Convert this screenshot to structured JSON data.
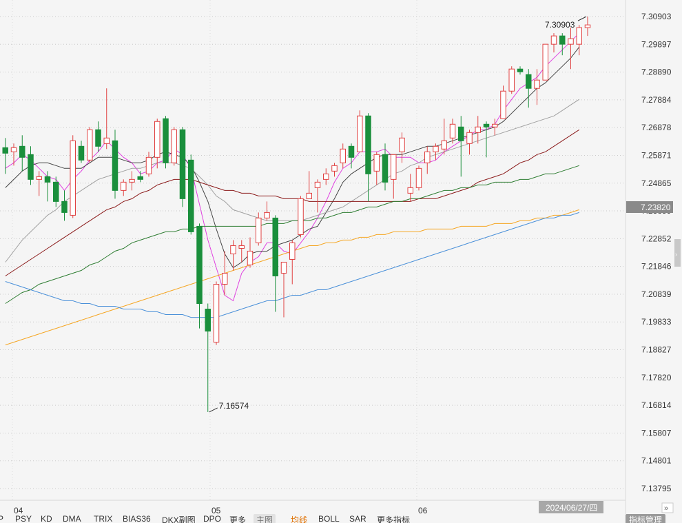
{
  "chart_data": {
    "type": "candlestick",
    "x_ticks": [
      "04",
      "05",
      "06"
    ],
    "y_ticks": [
      7.30903,
      7.29897,
      7.2889,
      7.27884,
      7.26878,
      7.25871,
      7.24865,
      7.23859,
      7.22852,
      7.21846,
      7.20839,
      7.19833,
      7.18827,
      7.1782,
      7.16814,
      7.15807,
      7.14801,
      7.13795
    ],
    "ylim": [
      7.13795,
      7.30903
    ],
    "last_price_label": "7.23820",
    "high_annotation": "7.30903",
    "low_annotation": "7.16574",
    "date_label": "2024/06/27/四",
    "grid": "horizontal dotted",
    "colors": {
      "up": "#e04040",
      "down": "#1a8f3c",
      "ma5": "#e040e0",
      "ma10": "#444444",
      "ma20": "#a0a0a0",
      "ma30": "#8b1a1a",
      "ma60": "#2e7d32",
      "ma120": "#f5a623",
      "ma250": "#4a90d9"
    },
    "candles": [
      [
        7.2615,
        7.265,
        7.252,
        7.2595
      ],
      [
        7.26,
        7.263,
        7.255,
        7.2615
      ],
      [
        7.262,
        7.266,
        7.253,
        7.258
      ],
      [
        7.259,
        7.262,
        7.248,
        7.25
      ],
      [
        7.25,
        7.253,
        7.244,
        7.251
      ],
      [
        7.251,
        7.253,
        7.242,
        7.249
      ],
      [
        7.249,
        7.251,
        7.24,
        7.242
      ],
      [
        7.242,
        7.246,
        7.235,
        7.238
      ],
      [
        7.237,
        7.266,
        7.236,
        7.264
      ],
      [
        7.262,
        7.264,
        7.256,
        7.257
      ],
      [
        7.257,
        7.269,
        7.256,
        7.268
      ],
      [
        7.268,
        7.271,
        7.26,
        7.262
      ],
      [
        7.263,
        7.283,
        7.261,
        7.265
      ],
      [
        7.264,
        7.268,
        7.243,
        7.246
      ],
      [
        7.246,
        7.25,
        7.244,
        7.249
      ],
      [
        7.249,
        7.253,
        7.246,
        7.25
      ],
      [
        7.251,
        7.253,
        7.249,
        7.25
      ],
      [
        7.252,
        7.26,
        7.251,
        7.258
      ],
      [
        7.258,
        7.272,
        7.254,
        7.271
      ],
      [
        7.272,
        7.273,
        7.254,
        7.256
      ],
      [
        7.256,
        7.269,
        7.255,
        7.268
      ],
      [
        7.268,
        7.269,
        7.24,
        7.243
      ],
      [
        7.257,
        7.259,
        7.23,
        7.231
      ],
      [
        7.233,
        7.234,
        7.196,
        7.205
      ],
      [
        7.203,
        7.205,
        7.1657,
        7.195
      ],
      [
        7.191,
        7.213,
        7.19,
        7.212
      ],
      [
        7.212,
        7.224,
        7.208,
        7.216
      ],
      [
        7.223,
        7.228,
        7.217,
        7.226
      ],
      [
        7.225,
        7.228,
        7.22,
        7.226
      ],
      [
        7.219,
        7.229,
        7.218,
        7.224
      ],
      [
        7.227,
        7.238,
        7.226,
        7.236
      ],
      [
        7.236,
        7.242,
        7.235,
        7.238
      ],
      [
        7.236,
        7.237,
        7.202,
        7.215
      ],
      [
        7.216,
        7.22,
        7.2,
        7.22
      ],
      [
        7.221,
        7.228,
        7.212,
        7.227
      ],
      [
        7.23,
        7.244,
        7.229,
        7.243
      ],
      [
        7.243,
        7.253,
        7.243,
        7.245
      ],
      [
        7.247,
        7.25,
        7.238,
        7.249
      ],
      [
        7.25,
        7.254,
        7.248,
        7.252
      ],
      [
        7.253,
        7.256,
        7.251,
        7.255
      ],
      [
        7.256,
        7.263,
        7.254,
        7.261
      ],
      [
        7.262,
        7.263,
        7.254,
        7.258
      ],
      [
        7.26,
        7.275,
        7.26,
        7.273
      ],
      [
        7.273,
        7.274,
        7.242,
        7.252
      ],
      [
        7.253,
        7.26,
        7.248,
        7.259
      ],
      [
        7.259,
        7.263,
        7.246,
        7.249
      ],
      [
        7.25,
        7.257,
        7.243,
        7.259
      ],
      [
        7.26,
        7.267,
        7.256,
        7.265
      ],
      [
        7.245,
        7.252,
        7.242,
        7.247
      ],
      [
        7.247,
        7.255,
        7.246,
        7.254
      ],
      [
        7.256,
        7.262,
        7.252,
        7.26
      ],
      [
        7.26,
        7.263,
        7.257,
        7.262
      ],
      [
        7.261,
        7.272,
        7.259,
        7.264
      ],
      [
        7.265,
        7.272,
        7.263,
        7.27
      ],
      [
        7.269,
        7.273,
        7.251,
        7.264
      ],
      [
        7.263,
        7.268,
        7.259,
        7.267
      ],
      [
        7.267,
        7.273,
        7.263,
        7.269
      ],
      [
        7.27,
        7.271,
        7.258,
        7.269
      ],
      [
        7.269,
        7.272,
        7.266,
        7.27
      ],
      [
        7.272,
        7.284,
        7.272,
        7.282
      ],
      [
        7.282,
        7.291,
        7.281,
        7.29
      ],
      [
        7.29,
        7.291,
        7.288,
        7.289
      ],
      [
        7.288,
        7.29,
        7.276,
        7.283
      ],
      [
        7.283,
        7.29,
        7.277,
        7.286
      ],
      [
        7.286,
        7.299,
        7.286,
        7.299
      ],
      [
        7.299,
        7.303,
        7.296,
        7.302
      ],
      [
        7.302,
        7.303,
        7.295,
        7.299
      ],
      [
        7.299,
        7.305,
        7.29,
        7.301
      ],
      [
        7.299,
        7.306,
        7.295,
        7.305
      ],
      [
        7.305,
        7.309,
        7.302,
        7.306
      ]
    ],
    "series": [
      {
        "key": "ma5",
        "values": [
          7.254,
          7.256,
          7.259,
          7.257,
          7.254,
          7.251,
          7.25,
          7.246,
          7.25,
          7.253,
          7.257,
          7.26,
          7.264,
          7.261,
          7.258,
          7.256,
          7.252,
          7.253,
          7.256,
          7.257,
          7.261,
          7.259,
          7.254,
          7.241,
          7.228,
          7.218,
          7.208,
          7.206,
          7.216,
          7.22,
          7.222,
          7.227,
          7.227,
          7.224,
          7.223,
          7.227,
          7.231,
          7.236,
          7.242,
          7.249,
          7.254,
          7.256,
          7.26,
          7.26,
          7.26,
          7.261,
          7.258,
          7.258,
          7.258,
          7.256,
          7.256,
          7.257,
          7.26,
          7.262,
          7.264,
          7.266,
          7.268,
          7.268,
          7.27,
          7.275,
          7.279,
          7.283,
          7.285,
          7.287,
          7.291,
          7.294,
          7.297,
          7.3,
          7.303
        ]
      },
      {
        "key": "ma10",
        "values": [
          7.247,
          7.25,
          7.253,
          7.255,
          7.256,
          7.256,
          7.255,
          7.254,
          7.254,
          7.254,
          7.256,
          7.258,
          7.258,
          7.258,
          7.257,
          7.256,
          7.256,
          7.257,
          7.259,
          7.26,
          7.259,
          7.258,
          7.255,
          7.249,
          7.242,
          7.232,
          7.223,
          7.218,
          7.22,
          7.223,
          7.224,
          7.224,
          7.226,
          7.227,
          7.228,
          7.23,
          7.232,
          7.233,
          7.238,
          7.243,
          7.249,
          7.252,
          7.254,
          7.256,
          7.258,
          7.259,
          7.259,
          7.259,
          7.26,
          7.261,
          7.262,
          7.262,
          7.263,
          7.264,
          7.265,
          7.266,
          7.267,
          7.268,
          7.269,
          7.271,
          7.274,
          7.277,
          7.28,
          7.283,
          7.285,
          7.288,
          7.291,
          7.294,
          7.298
        ]
      },
      {
        "key": "ma20",
        "values": [
          7.22,
          7.224,
          7.228,
          7.231,
          7.234,
          7.237,
          7.239,
          7.242,
          7.244,
          7.246,
          7.248,
          7.25,
          7.251,
          7.252,
          7.253,
          7.254,
          7.254,
          7.255,
          7.256,
          7.256,
          7.256,
          7.255,
          7.254,
          7.251,
          7.248,
          7.244,
          7.242,
          7.239,
          7.238,
          7.237,
          7.236,
          7.235,
          7.235,
          7.235,
          7.235,
          7.235,
          7.236,
          7.237,
          7.238,
          7.239,
          7.24,
          7.242,
          7.244,
          7.246,
          7.248,
          7.25,
          7.252,
          7.253,
          7.255,
          7.256,
          7.258,
          7.259,
          7.26,
          7.261,
          7.262,
          7.263,
          7.264,
          7.265,
          7.266,
          7.267,
          7.268,
          7.269,
          7.27,
          7.271,
          7.272,
          7.273,
          7.275,
          7.277,
          7.279
        ]
      },
      {
        "key": "ma30",
        "values": [
          7.215,
          7.217,
          7.219,
          7.221,
          7.223,
          7.225,
          7.227,
          7.229,
          7.231,
          7.233,
          7.235,
          7.237,
          7.239,
          7.24,
          7.242,
          7.243,
          7.245,
          7.246,
          7.248,
          7.249,
          7.25,
          7.25,
          7.25,
          7.249,
          7.248,
          7.247,
          7.246,
          7.246,
          7.245,
          7.245,
          7.244,
          7.244,
          7.244,
          7.243,
          7.243,
          7.243,
          7.242,
          7.242,
          7.242,
          7.242,
          7.242,
          7.242,
          7.242,
          7.242,
          7.242,
          7.242,
          7.242,
          7.242,
          7.242,
          7.243,
          7.243,
          7.243,
          7.244,
          7.245,
          7.246,
          7.247,
          7.249,
          7.25,
          7.251,
          7.252,
          7.254,
          7.256,
          7.257,
          7.259,
          7.26,
          7.262,
          7.264,
          7.266,
          7.268
        ]
      },
      {
        "key": "ma60",
        "values": [
          7.205,
          7.207,
          7.209,
          7.21,
          7.212,
          7.213,
          7.214,
          7.215,
          7.216,
          7.217,
          7.219,
          7.22,
          7.222,
          7.224,
          7.225,
          7.227,
          7.228,
          7.229,
          7.23,
          7.231,
          7.231,
          7.232,
          7.232,
          7.233,
          7.233,
          7.233,
          7.233,
          7.233,
          7.233,
          7.233,
          7.233,
          7.234,
          7.234,
          7.234,
          7.235,
          7.235,
          7.235,
          7.236,
          7.236,
          7.237,
          7.238,
          7.238,
          7.239,
          7.24,
          7.24,
          7.241,
          7.242,
          7.242,
          7.243,
          7.243,
          7.244,
          7.245,
          7.246,
          7.246,
          7.247,
          7.247,
          7.248,
          7.248,
          7.249,
          7.249,
          7.249,
          7.25,
          7.25,
          7.251,
          7.252,
          7.252,
          7.253,
          7.254,
          7.255
        ]
      },
      {
        "key": "ma120",
        "values": [
          7.19,
          7.191,
          7.192,
          7.193,
          7.194,
          7.195,
          7.196,
          7.197,
          7.198,
          7.199,
          7.2,
          7.201,
          7.202,
          7.203,
          7.204,
          7.205,
          7.206,
          7.207,
          7.208,
          7.209,
          7.21,
          7.211,
          7.212,
          7.213,
          7.214,
          7.215,
          7.216,
          7.217,
          7.218,
          7.219,
          7.22,
          7.221,
          7.222,
          7.223,
          7.224,
          7.225,
          7.226,
          7.226,
          7.227,
          7.227,
          7.228,
          7.228,
          7.229,
          7.229,
          7.23,
          7.23,
          7.231,
          7.231,
          7.231,
          7.231,
          7.232,
          7.232,
          7.232,
          7.232,
          7.233,
          7.233,
          7.233,
          7.233,
          7.234,
          7.234,
          7.234,
          7.235,
          7.235,
          7.236,
          7.236,
          7.237,
          7.237,
          7.238,
          7.239
        ]
      },
      {
        "key": "ma250",
        "values": [
          7.213,
          7.212,
          7.211,
          7.21,
          7.209,
          7.208,
          7.207,
          7.206,
          7.206,
          7.205,
          7.205,
          7.204,
          7.204,
          7.204,
          7.203,
          7.203,
          7.203,
          7.202,
          7.202,
          7.201,
          7.201,
          7.201,
          7.2,
          7.2,
          7.2,
          7.2,
          7.201,
          7.202,
          7.203,
          7.204,
          7.205,
          7.206,
          7.206,
          7.207,
          7.208,
          7.208,
          7.209,
          7.21,
          7.21,
          7.211,
          7.212,
          7.213,
          7.214,
          7.215,
          7.216,
          7.217,
          7.218,
          7.219,
          7.22,
          7.221,
          7.222,
          7.223,
          7.224,
          7.225,
          7.226,
          7.227,
          7.228,
          7.229,
          7.23,
          7.231,
          7.232,
          7.233,
          7.234,
          7.235,
          7.236,
          7.236,
          7.237,
          7.237,
          7.238
        ]
      }
    ]
  },
  "toolbar": {
    "items": [
      {
        "label": "P"
      },
      {
        "label": "PSY"
      },
      {
        "label": "KD"
      },
      {
        "label": "DMA"
      },
      {
        "label": "TRIX"
      },
      {
        "label": "BIAS36"
      },
      {
        "label": "DKX副图"
      },
      {
        "label": "DPO"
      },
      {
        "label": "更多"
      },
      {
        "label": "主图"
      },
      {
        "label": "均线"
      },
      {
        "label": "BOLL"
      },
      {
        "label": "SAR"
      },
      {
        "label": "更多指标"
      },
      {
        "label": "指标管理"
      }
    ],
    "scroll_label": "»"
  }
}
